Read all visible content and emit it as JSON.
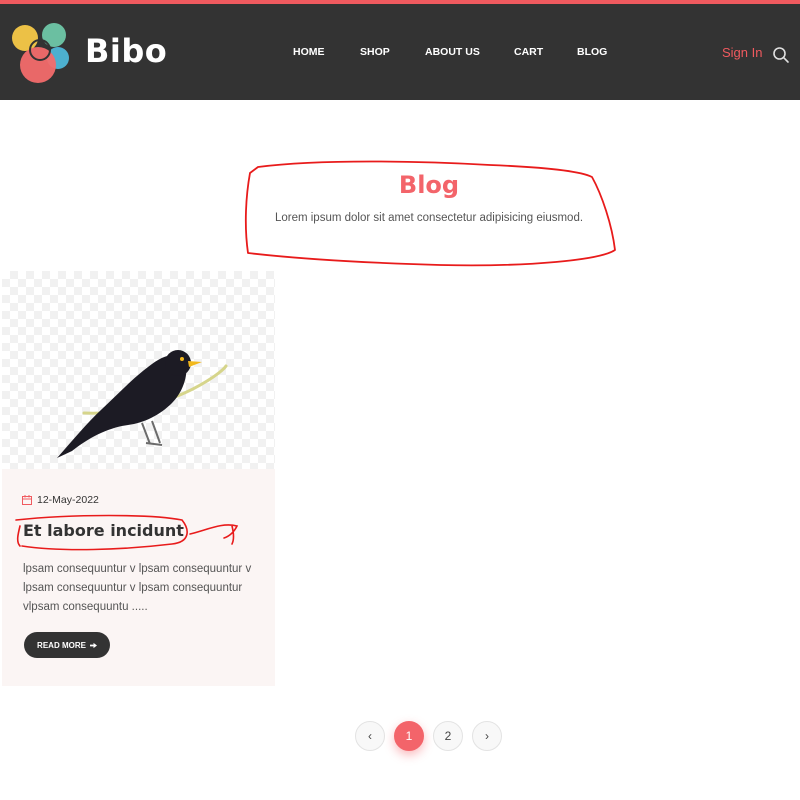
{
  "brand": {
    "name": "Bibo",
    "accent_color": "#f05a5f",
    "header_bg": "#333333"
  },
  "nav": {
    "items": [
      "HOME",
      "SHOP",
      "ABOUT US",
      "CART",
      "BLOG"
    ],
    "signin": "Sign In",
    "search_icon": "search-icon"
  },
  "hero": {
    "title": "Blog",
    "subtitle": "Lorem ipsum dolor sit amet consectetur adipisicing eiusmod."
  },
  "posts": [
    {
      "date": "12-May-2022",
      "title": "Et labore incidunt",
      "excerpt": "lpsam consequuntur v lpsam consequuntur v lpsam consequuntur v lpsam consequuntur vlpsam consequuntu .....",
      "read_more": "READ MORE",
      "image": "blackbird-icon"
    }
  ],
  "pagination": {
    "prev": "‹",
    "pages": [
      "1",
      "2"
    ],
    "current": "1",
    "next": "›"
  }
}
